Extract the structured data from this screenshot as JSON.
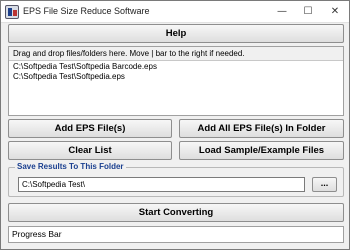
{
  "window": {
    "title": "EPS File Size Reduce Software",
    "minimize_glyph": "—",
    "maximize_glyph": "☐",
    "close_glyph": "✕",
    "icon": "app-icon"
  },
  "help_button": "Help",
  "file_list": {
    "header": "Drag and drop files/folders here. Move | bar to the right if needed.",
    "items": [
      "C:\\Softpedia Test\\Softpedia Barcode.eps",
      "C:\\Softpedia Test\\Softpedia.eps"
    ]
  },
  "buttons": {
    "add_files": "Add EPS File(s)",
    "add_all_in_folder": "Add All EPS File(s) In Folder",
    "clear_list": "Clear List",
    "load_sample": "Load Sample/Example Files",
    "start_converting": "Start Converting"
  },
  "save_results": {
    "label": "Save Results To This Folder",
    "folder_value": "C:\\Softpedia Test\\",
    "browse_label": "..."
  },
  "progress_bar": {
    "label": "Progress Bar"
  }
}
